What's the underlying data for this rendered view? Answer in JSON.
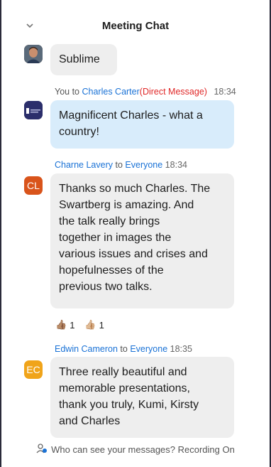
{
  "header": {
    "title": "Meeting Chat",
    "collapse_icon": "chevron-down-icon"
  },
  "messages": [
    {
      "text": "Sublime",
      "avatar": "photo"
    },
    {
      "sender": "You",
      "to_word": "to",
      "recipient": "Charles Carter",
      "direct_tag": "(Direct Message)",
      "time": "18:34",
      "text_line1": "Magnificent Charles - what a",
      "text_line2": "country!",
      "avatar_color": "#2b2e6b"
    },
    {
      "sender": "Charne Lavery",
      "to_word": "to",
      "recipient": "Everyone",
      "time": "18:34",
      "avatar_initials": "CL",
      "avatar_color": "#d9541b",
      "lines": [
        "Thanks so much Charles. The",
        "Swartberg is amazing. And",
        "the talk really brings",
        "together in images the",
        "various issues and crises and",
        "hopefulnesses of the",
        "previous two talks."
      ],
      "reactions": [
        {
          "emoji": "👍🏽",
          "count": "1"
        },
        {
          "emoji": "👍🏼",
          "count": "1"
        }
      ]
    },
    {
      "sender": "Edwin Cameron",
      "to_word": "to",
      "recipient": "Everyone",
      "time": "18:35",
      "avatar_initials": "EC",
      "avatar_color": "#f0a41a",
      "lines": [
        "Three really beautiful and",
        "memorable presentations,",
        "thank you truly, Kumi, Kirsty",
        "and Charles"
      ]
    }
  ],
  "footer": {
    "text": "Who can see your messages? Recording On",
    "icon": "person-visibility-icon"
  },
  "colors": {
    "link_blue": "#1a72d6",
    "direct_red": "#e02828",
    "bubble_gray": "#eeeeee",
    "bubble_blue": "#d8ecfb"
  }
}
